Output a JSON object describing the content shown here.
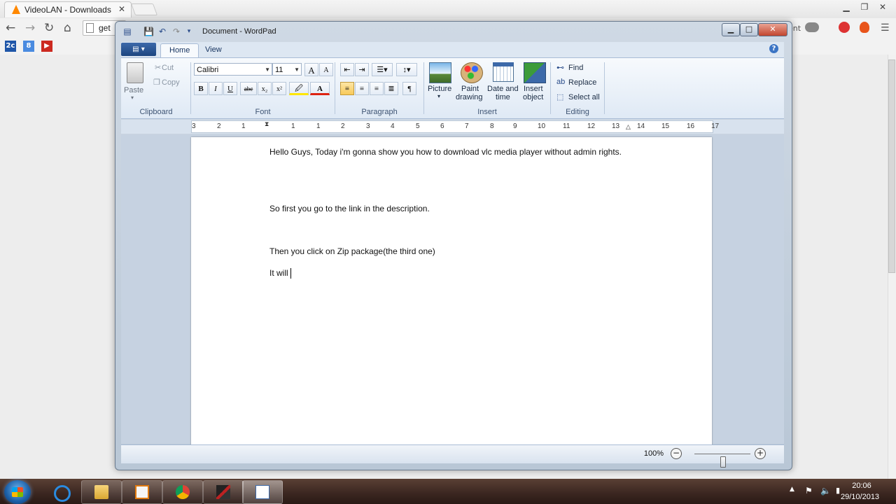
{
  "browser": {
    "tab_title": "VideoLAN - Downloads",
    "tab_close": "✕",
    "address_partial": "get",
    "right_text": "ent",
    "bookmarks": [
      {
        "label": "2c",
        "color": "#1f56a8"
      },
      {
        "label": "8",
        "color": "#4a8be0"
      },
      {
        "label": "▶",
        "color": "#cc2a20"
      }
    ]
  },
  "wordpad": {
    "title": "Document - WordPad",
    "tabs": [
      {
        "label": "Home",
        "active": true
      },
      {
        "label": "View",
        "active": false
      }
    ],
    "app_menu_icon": "▤ ▾",
    "help": "?",
    "clipboard": {
      "paste": "Paste",
      "cut": "Cut",
      "copy": "Copy",
      "group": "Clipboard"
    },
    "font": {
      "family": "Calibri",
      "size": "11",
      "group": "Font",
      "bold": "B",
      "italic": "I",
      "underline": "U",
      "strike": "abc",
      "subscript": "x₂",
      "superscript": "x²",
      "grow": "A",
      "shrink": "A",
      "highlight": "🖉",
      "color": "A"
    },
    "paragraph": {
      "group": "Paragraph"
    },
    "insert": {
      "group": "Insert",
      "picture": "Picture",
      "paint_1": "Paint",
      "paint_2": "drawing",
      "datetime_1": "Date and",
      "datetime_2": "time",
      "object_1": "Insert",
      "object_2": "object"
    },
    "editing": {
      "group": "Editing",
      "find": "Find",
      "replace": "Replace",
      "select_all": "Select all"
    },
    "ruler_numbers": [
      "3",
      "2",
      "1",
      "1",
      "1",
      "2",
      "3",
      "4",
      "5",
      "6",
      "7",
      "8",
      "9",
      "10",
      "11",
      "12",
      "13",
      "14",
      "15",
      "16",
      "17"
    ],
    "document": {
      "paragraphs": [
        "Hello Guys, Today i'm gonna show you how to download vlc media player without admin rights.",
        "So first you go to the link in the description.",
        "Then you click on Zip package(the third one)",
        "It will"
      ]
    },
    "status": {
      "zoom": "100%",
      "zoom_level_percent": 100
    }
  },
  "taskbar": {
    "apps": [
      "internet-explorer",
      "file-explorer",
      "media-player",
      "chrome",
      "game",
      "wordpad"
    ],
    "time": "20:06",
    "date": "29/10/2013"
  },
  "colors": {
    "ribbon_accent": "#1d4681",
    "taskbar": "#3a2620",
    "selected_button": "#f8c959"
  }
}
